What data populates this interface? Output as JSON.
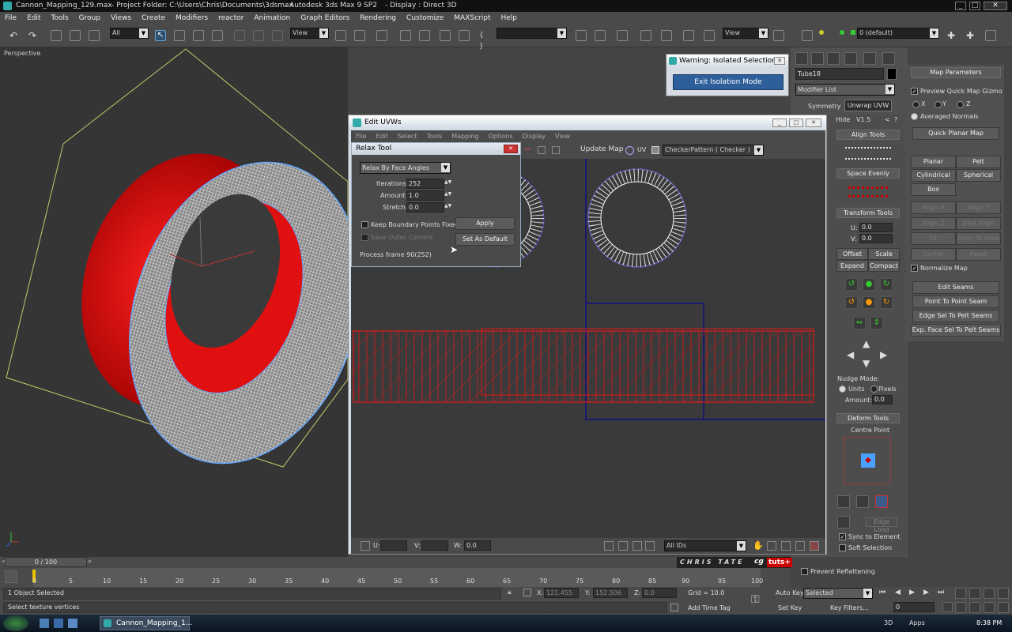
{
  "title": {
    "file": "Cannon_Mapping_129.max",
    "project": "- Project Folder: C:\\Users\\Chris\\Documents\\3dsmax",
    "app": "- Autodesk 3ds Max 9 SP2",
    "display": "- Display : Direct 3D"
  },
  "menu": [
    "File",
    "Edit",
    "Tools",
    "Group",
    "Views",
    "Create",
    "Modifiers",
    "reactor",
    "Animation",
    "Graph Editors",
    "Rendering",
    "Customize",
    "MAXScript",
    "Help"
  ],
  "toolbar": {
    "selection_filter": "All",
    "ref_coord": "View",
    "named_sel": "",
    "view2": "View",
    "layer": "0 (default)"
  },
  "viewport": {
    "label": "Perspective"
  },
  "warning": {
    "title": "Warning: Isolated Selection",
    "button": "Exit Isolation Mode"
  },
  "edit_uvws": {
    "title": "Edit UVWs",
    "menu": [
      "File",
      "Edit",
      "Select",
      "Tools",
      "Mapping",
      "Options",
      "Display",
      "View"
    ],
    "update_map": "Update Map",
    "texture": "CheckerPattern ( Checker )",
    "u_label": "U:",
    "v_label": "V:",
    "w_label": "W:",
    "w_value": "0.0",
    "ids": "All IDs"
  },
  "relax": {
    "title": "Relax Tool",
    "mode": "Relax By Face Angles",
    "iterations_label": "Iterations:",
    "iterations": "252",
    "amount_label": "Amount:",
    "amount": "1.0",
    "stretch_label": "Stretch:",
    "stretch": "0.0",
    "keep_boundary": "Keep Boundary Points Fixed",
    "save_outer": "Save Outer Corners",
    "apply": "Apply",
    "set_default": "Set As Default",
    "status": "Process frame 90(252)"
  },
  "uv_side": {
    "hide": "Hide",
    "version": "V1.5",
    "help": "?",
    "align_tools": "Align Tools",
    "space_evenly": "Space Evenly",
    "transform_tools": "Transform Tools",
    "u_label": "U:",
    "u": "0.0",
    "v_label": "V:",
    "v": "0.0",
    "offset": "Offset",
    "scale": "Scale",
    "expand": "Expand",
    "compact": "Compact",
    "nudge_mode": "Nudge Mode:",
    "units": "Units",
    "pixels": "Pixels",
    "amount_label": "Amount:",
    "amount": "0.0",
    "deform_tools": "Deform Tools",
    "centre_point": "Centre Point",
    "edge_loop": "Edge Loop",
    "sync": "Sync to Element",
    "soft": "Soft Selection"
  },
  "cmd_panel": {
    "object_name": "Tube18",
    "modifier_list": "Modifier List",
    "symmetry": "Symmetry",
    "unwrap": "Unwrap UVW",
    "prevent": "Prevent Reflattening"
  },
  "map_params": {
    "title": "Map Parameters",
    "preview": "Preview Quick Map Gizmo",
    "x": "X",
    "y": "Y",
    "z": "Z",
    "averaged": "Averaged Normals",
    "quick_planar": "Quick Planar Map",
    "planar": "Planar",
    "pelt": "Pelt",
    "cylindrical": "Cylindrical",
    "spherical": "Spherical",
    "box": "Box",
    "align_x": "Align X",
    "align_y": "Align Y",
    "align_z": "Align Z",
    "best_align": "Best Align",
    "fit": "Fit",
    "align_to_view": "Align To View",
    "center": "Center",
    "reset": "Reset",
    "normalize": "Normalize Map",
    "edit_seams": "Edit Seams",
    "point_to_point": "Point To Point Seam",
    "edge_sel": "Edge Sel To Pelt Seams",
    "exp_face": "Exp. Face Sel To Pelt Seams"
  },
  "timeline": {
    "frame": "0 / 100",
    "ticks": [
      "0",
      "5",
      "10",
      "15",
      "20",
      "25",
      "30",
      "35",
      "40",
      "45",
      "50",
      "55",
      "60",
      "65",
      "70",
      "75",
      "80",
      "85",
      "90",
      "95",
      "100"
    ],
    "watermark": "CHRIS TATE",
    "logo1": "cg",
    "logo2": "tuts+"
  },
  "status": {
    "selected": "1 Object Selected",
    "prompt": "Select texture vertices",
    "x_label": "X:",
    "x": "121.455",
    "y_label": "Y:",
    "y": "152.506",
    "z_label": "Z:",
    "z": "0.0",
    "grid": "Grid = 10.0",
    "add_time": "Add Time Tag",
    "auto_key": "Auto Key",
    "auto_key_mode": "Selected",
    "set_key": "Set Key",
    "key_filters": "Key Filters...",
    "frame_field": "0"
  },
  "taskbar": {
    "task": "Cannon_Mapping_1...",
    "tray": "3D",
    "apps": "Apps",
    "time": "8:38 PM"
  },
  "colors": {
    "uv_red": "#e01818",
    "mesh_blue": "#66aaff",
    "brand_red": "#cc0000"
  }
}
